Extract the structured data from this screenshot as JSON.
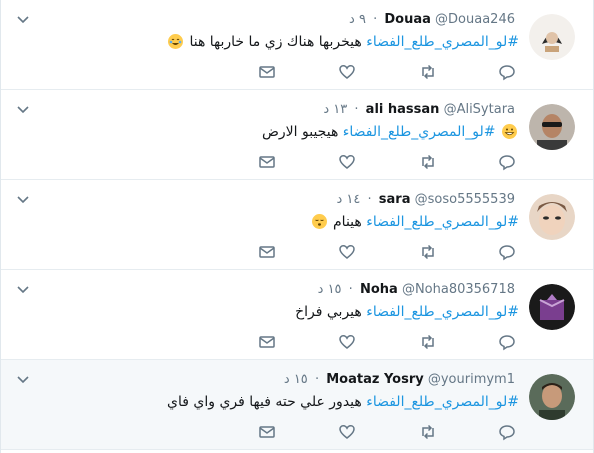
{
  "hashtag": "#لو_المصري_طلع_الفضاء",
  "tweets": [
    {
      "name": "Douaa",
      "handle": "@Douaa246",
      "time": "٩ د",
      "text": "هيخربها  هناك زي ما خاربها هنا",
      "emoji": "joy-emoji",
      "highlight": false
    },
    {
      "name": "ali hassan",
      "handle": "@AliSytara",
      "time": "١٣ د",
      "text": "هيجيبو الارض",
      "emoji": "grin-emoji",
      "highlight": false
    },
    {
      "name": "sara",
      "handle": "@soso5555539",
      "time": "١٤ د",
      "text": "هينام",
      "emoji": "sleeping-emoji",
      "highlight": false
    },
    {
      "name": "Noha",
      "handle": "@Noha80356718",
      "time": "١٥ د",
      "text": "هيربي فراخ",
      "emoji": "",
      "highlight": false
    },
    {
      "name": "Moataz Yosry",
      "handle": "@yourimym1",
      "time": "١٥ د",
      "text": "هيدور علي حته فيها فري واي فاي",
      "emoji": "",
      "highlight": true
    }
  ],
  "icons": {
    "reply": "reply-icon",
    "retweet": "retweet-icon",
    "like": "like-icon",
    "dm": "direct-message-icon",
    "menu": "chevron-down-icon"
  },
  "colors": {
    "hashtag": "#1b95e0",
    "meta": "#657786",
    "icon": "#657786",
    "highlight_bg": "#f5f8fa"
  }
}
